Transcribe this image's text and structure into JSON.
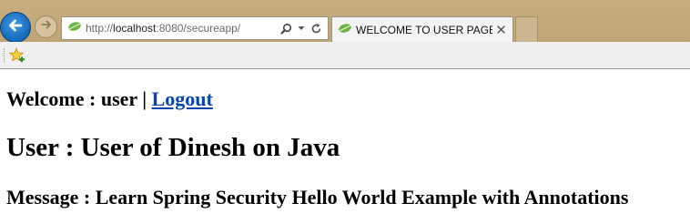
{
  "browser": {
    "url_prefix": "http://",
    "url_host": "localhost",
    "url_rest": ":8080/secureapp/",
    "tab_title": "WELCOME TO USER PAGE ...",
    "tab_close": "×",
    "icons": {
      "back": "back-arrow-icon",
      "forward": "forward-arrow-icon",
      "favicon": "spring-leaf-icon",
      "search": "search-icon",
      "dropdown": "dropdown-icon",
      "refresh": "refresh-icon",
      "favorites": "add-favorites-star-icon"
    },
    "colors": {
      "frame": "#c3a97b",
      "back_button": "#1b75c9",
      "favicon": "#6db33f"
    }
  },
  "page": {
    "welcome_prefix": "Welcome : user |",
    "logout_label": "Logout",
    "user_line": "User : User of Dinesh on Java",
    "message_line": "Message : Learn Spring Security Hello World Example with Annotations",
    "colors": {
      "link": "#0645ad",
      "text": "#000000"
    }
  }
}
